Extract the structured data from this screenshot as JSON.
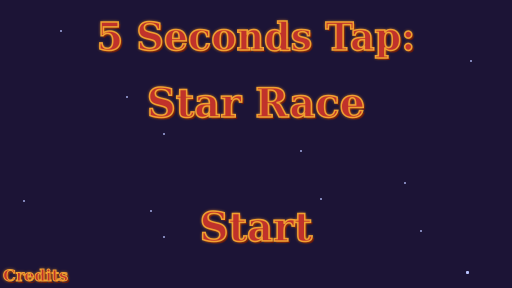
{
  "title": {
    "line1": "5 Seconds Tap:",
    "line2": "Star Race"
  },
  "menu": {
    "start_label": "Start",
    "credits_label": "Credits"
  },
  "colors": {
    "background": "#1c1436",
    "text_fill": "#c0322b",
    "text_outline": "#f0a030",
    "star": "#b9c3ff"
  }
}
